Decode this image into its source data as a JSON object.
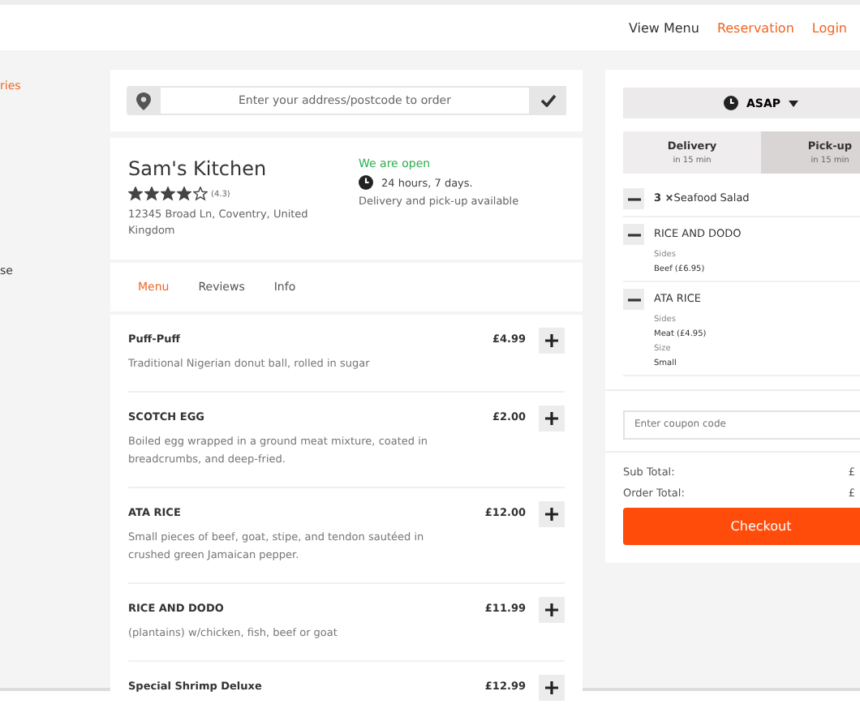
{
  "nav": [
    {
      "label": "View Menu",
      "kind": "plain"
    },
    {
      "label": "Reservation",
      "kind": "accent"
    },
    {
      "label": "Login",
      "kind": "accent"
    }
  ],
  "sidebar": {
    "items": [
      {
        "label": "ries",
        "selected": true
      },
      {
        "label": "se",
        "selected": false
      }
    ]
  },
  "address": {
    "placeholder": "Enter your address/postcode to order"
  },
  "restaurant": {
    "name": "Sam's Kitchen",
    "stars": 4,
    "rating": "(4.3)",
    "address": "12345 Broad Ln, Coventry, United Kingdom",
    "status": "We are open",
    "hours": "24 hours, 7 days.",
    "services": "Delivery and pick-up available"
  },
  "tabs": [
    {
      "label": "Menu",
      "selected": true
    },
    {
      "label": "Reviews",
      "selected": false
    },
    {
      "label": "Info",
      "selected": false
    }
  ],
  "menu_items": [
    {
      "name": "Puff-Puff",
      "description": "Traditional Nigerian donut ball, rolled in sugar",
      "price": "£4.99"
    },
    {
      "name": "SCOTCH EGG",
      "description": "Boiled egg wrapped in a ground meat mixture, coated in breadcrumbs, and deep-fried.",
      "price": "£2.00"
    },
    {
      "name": "ATA RICE",
      "description": "Small pieces of beef, goat, stipe, and tendon sautéed in crushed green Jamaican pepper.",
      "price": "£12.00"
    },
    {
      "name": "RICE AND DODO",
      "description": "(plantains) w/chicken, fish, beef or goat",
      "price": "£11.99"
    },
    {
      "name": "Special Shrimp Deluxe",
      "price": "£12.99"
    }
  ],
  "order": {
    "time": "ASAP",
    "modes": [
      {
        "label": "Delivery",
        "eta": "in 15 min",
        "selected": false
      },
      {
        "label": "Pick-up",
        "eta": "in 15 min",
        "selected": true
      }
    ],
    "cart": [
      {
        "quantity": "3 ×",
        "name": "Seafood Salad"
      },
      {
        "name": "RICE AND DODO",
        "options": [
          {
            "label": "Sides",
            "value": "Beef (£6.95)"
          }
        ]
      },
      {
        "name": "ATA RICE",
        "options": [
          {
            "label": "Sides",
            "value": "Meat (£4.95)"
          },
          {
            "label": "Size",
            "value": "Small"
          }
        ]
      }
    ],
    "coupon": {
      "placeholder": "Enter coupon code"
    },
    "totals": [
      {
        "label": "Sub Total:",
        "value": "£"
      },
      {
        "label": "Order Total:",
        "value": "£"
      }
    ],
    "checkout": "Checkout"
  }
}
